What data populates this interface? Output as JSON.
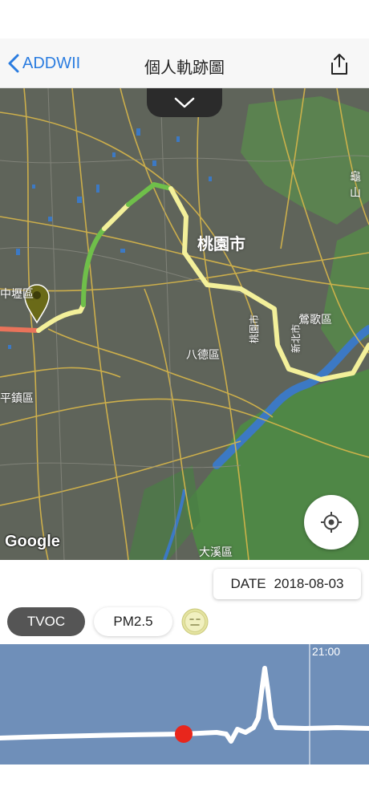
{
  "nav": {
    "back_label": "ADDWII",
    "title": "個人軌跡圖"
  },
  "map": {
    "labels": {
      "taoyuan": "桃園市",
      "zhongli": "中壢區",
      "pingzhen": "平鎮區",
      "bade": "八德區",
      "yingge": "鶯歌區",
      "guishan": "龜山",
      "daxi": "大溪區",
      "taoyuan_city_road": "桃園市",
      "new_taipei_road": "新北市"
    },
    "attribution": "Google",
    "route_colors": [
      "#e9735a",
      "#f3f09a",
      "#6fbf4a"
    ]
  },
  "date": {
    "label": "DATE",
    "value": "2018-08-03"
  },
  "tabs": {
    "tvoc": "TVOC",
    "pm25": "PM2.5"
  },
  "chart": {
    "time_label": "21:00",
    "background": "#6f8fb9",
    "line_color": "#ffffff",
    "marker_color": "#e8261c"
  }
}
